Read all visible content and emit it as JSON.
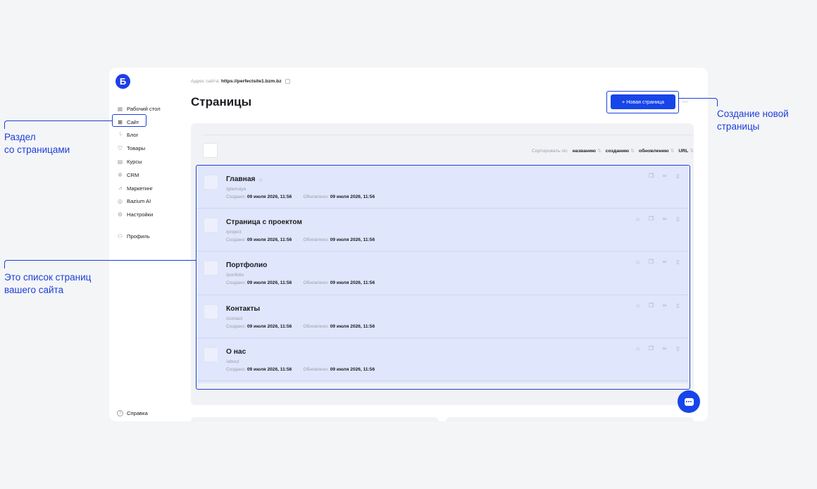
{
  "app": {
    "logo_letter": "Б",
    "site_address_label": "Адрес сайта:",
    "site_address_url": "https://perfectsite1.bzm.bz",
    "page_title": "Страницы",
    "new_page_button": "+ Новая страница",
    "more_button": "···"
  },
  "sidebar": {
    "items": [
      {
        "label": "Рабочий стол",
        "icon": "dashboard-icon",
        "glyph": "▦"
      },
      {
        "label": "Сайт",
        "icon": "site-icon",
        "glyph": "⊞"
      },
      {
        "label": "Блог",
        "icon": "sub-branch-icon",
        "glyph": "└"
      },
      {
        "label": "Товары",
        "icon": "bag-icon",
        "glyph": "⛉"
      },
      {
        "label": "Курсы",
        "icon": "book-icon",
        "glyph": "▤"
      },
      {
        "label": "CRM",
        "icon": "crm-icon",
        "glyph": "✲"
      },
      {
        "label": "Маркетинг",
        "icon": "chart-icon",
        "glyph": "⩘"
      },
      {
        "label": "Bazium AI",
        "icon": "ai-icon",
        "glyph": "◎"
      },
      {
        "label": "Настройки",
        "icon": "gear-icon",
        "glyph": "⚙"
      },
      {
        "label": "Профиль",
        "icon": "user-icon",
        "glyph": "⚇"
      }
    ],
    "help_label": "Справка",
    "help_glyph": "?"
  },
  "toolbar": {
    "sort_label": "Сортировать по:",
    "sort_options": [
      "названию",
      "созданию",
      "обновлению",
      "URL"
    ],
    "sort_arrow": "⇅"
  },
  "pages": {
    "created_label": "Создано:",
    "updated_label": "Обновлено:",
    "rows": [
      {
        "title": "Главная",
        "slug": "/glavnaya",
        "created": "09 июля 2026, 11:56",
        "updated": "09 июля 2026, 11:56",
        "is_home": true
      },
      {
        "title": "Страница с проектом",
        "slug": "/project",
        "created": "09 июля 2026, 11:56",
        "updated": "09 июля 2026, 11:56",
        "is_home": false
      },
      {
        "title": "Портфолио",
        "slug": "/portfolio",
        "created": "09 июля 2026, 11:56",
        "updated": "09 июля 2026, 11:56",
        "is_home": false
      },
      {
        "title": "Контакты",
        "slug": "/contact",
        "created": "09 июля 2026, 11:56",
        "updated": "09 июля 2026, 11:56",
        "is_home": false
      },
      {
        "title": "О нас",
        "slug": "/about",
        "created": "09 июля 2026, 11:56",
        "updated": "09 июля 2026, 11:56",
        "is_home": false
      }
    ]
  },
  "annotations": {
    "section": "Раздел\nсо страницами",
    "list": "Это список страниц\nвашего сайта",
    "create": "Создание новой\nстраницы",
    "color": "#1e3fd8"
  },
  "colors": {
    "accent": "#1645ea",
    "list_highlight": "#e0e6fb"
  }
}
